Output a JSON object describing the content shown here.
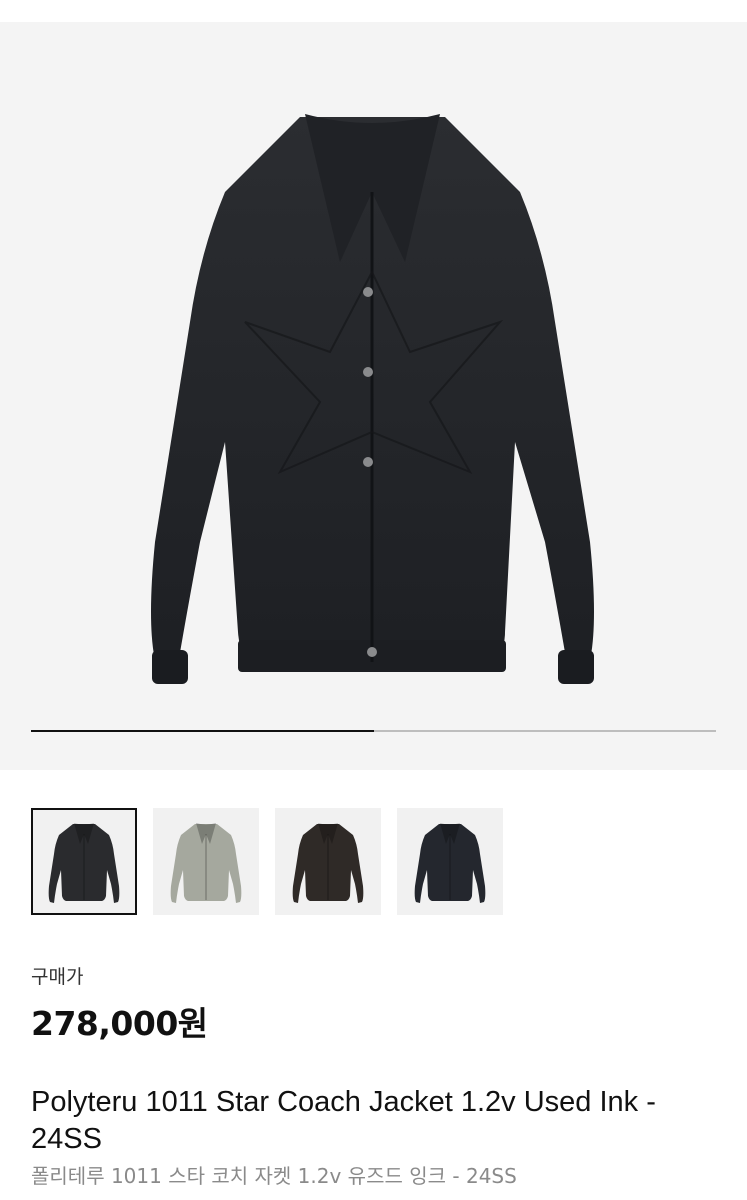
{
  "product": {
    "main_image": {
      "icon": "black-coach-jacket",
      "alt": "product-photo"
    },
    "gallery_progress": 0.5,
    "thumbnails": [
      {
        "icon": "black-jacket-thumbnail",
        "color": "#2a2b2e",
        "selected": true
      },
      {
        "icon": "khaki-jacket-thumbnail",
        "color": "#a5a89e",
        "selected": false
      },
      {
        "icon": "dark-brown-jacket-thumbnail",
        "color": "#2f2a27",
        "selected": false
      },
      {
        "icon": "navy-jacket-thumbnail",
        "color": "#24272e",
        "selected": false
      }
    ],
    "price_label": "구매가",
    "price": "278,000원",
    "title": "Polyteru 1011 Star Coach Jacket 1.2v Used Ink - 24SS",
    "subtitle": "폴리테루 1011 스타 코치 자켓 1.2v 유즈드 잉크 - 24SS"
  },
  "colors": {
    "hero_bg": "#f4f4f4",
    "progress_active": "#111111",
    "progress_track": "#bdbdbd"
  }
}
